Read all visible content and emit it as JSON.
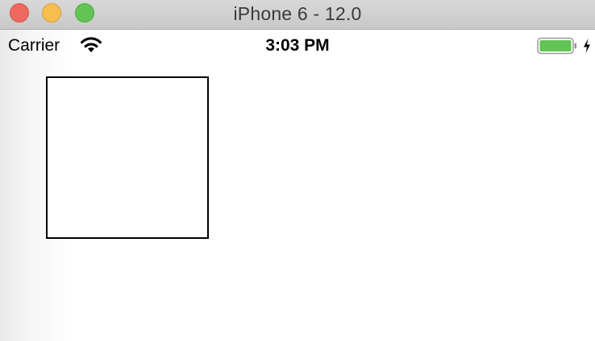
{
  "window": {
    "title": "iPhone 6 - 12.0",
    "controls": [
      "close",
      "minimize",
      "zoom"
    ],
    "colors": {
      "close": "#ee6a5e",
      "minimize": "#f5be4f",
      "zoom": "#61c454"
    }
  },
  "status_bar": {
    "carrier": "Carrier",
    "signal_icon": "wifi-icon",
    "time": "3:03 PM",
    "battery_icon": "battery-icon",
    "battery_color": "#61c454",
    "battery_level": 1.0,
    "charging_icon": "charging-bolt-icon"
  },
  "content": {
    "square_border_color": "#000000"
  }
}
